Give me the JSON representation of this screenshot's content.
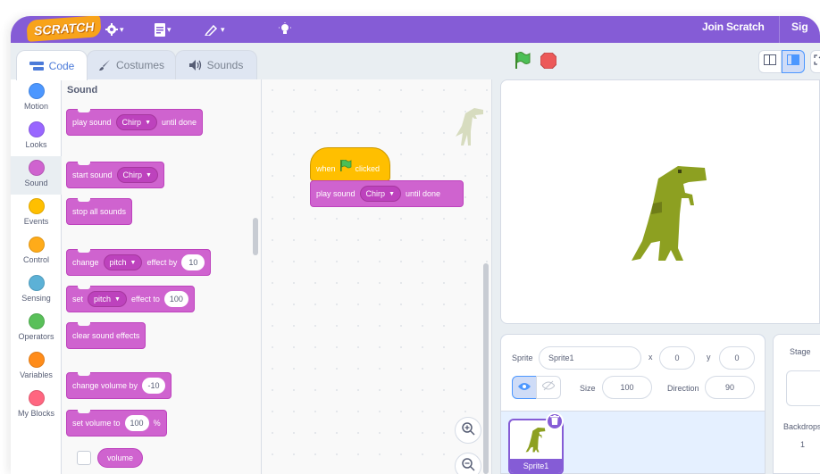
{
  "menubar": {
    "logo": "SCRATCH",
    "join_label": "Join Scratch",
    "signin_label": "Sig",
    "icons": [
      "globe-icon",
      "file-icon",
      "edit-icon",
      "tutorials-icon"
    ]
  },
  "tabs": [
    {
      "label": "Code",
      "icon": "code-icon",
      "active": true
    },
    {
      "label": "Costumes",
      "icon": "brush-icon",
      "active": false
    },
    {
      "label": "Sounds",
      "icon": "speaker-icon",
      "active": false
    }
  ],
  "categories": [
    {
      "label": "Motion",
      "color": "#4c97ff"
    },
    {
      "label": "Looks",
      "color": "#9966ff"
    },
    {
      "label": "Sound",
      "color": "#cf63cf",
      "active": true
    },
    {
      "label": "Events",
      "color": "#ffbf00"
    },
    {
      "label": "Control",
      "color": "#ffab19"
    },
    {
      "label": "Sensing",
      "color": "#5cb1d6"
    },
    {
      "label": "Operators",
      "color": "#59c059"
    },
    {
      "label": "Variables",
      "color": "#ff8c1a"
    },
    {
      "label": "My Blocks",
      "color": "#ff6680"
    }
  ],
  "palette": {
    "title": "Sound",
    "play_until_done": {
      "text1": "play sound",
      "sound": "Chirp",
      "text2": "until done"
    },
    "start_sound": {
      "text1": "start sound",
      "sound": "Chirp"
    },
    "stop_all": "stop all sounds",
    "change_effect": {
      "text1": "change",
      "effect": "pitch",
      "text2": "effect by",
      "value": "10"
    },
    "set_effect": {
      "text1": "set",
      "effect": "pitch",
      "text2": "effect to",
      "value": "100"
    },
    "clear_effects": "clear sound effects",
    "change_volume": {
      "text1": "change volume by",
      "value": "-10"
    },
    "set_volume": {
      "text1": "set volume to",
      "value": "100",
      "unit": "%"
    },
    "volume_reporter": "volume"
  },
  "script": {
    "hat": {
      "text1": "when",
      "text2": "clicked"
    },
    "play": {
      "text1": "play sound",
      "sound": "Chirp",
      "text2": "until done"
    }
  },
  "controls": {
    "green_flag": "green-flag-icon",
    "stop": "stop-icon"
  },
  "colors": {
    "menubar": "#855cd6",
    "sound_block": "#cf63cf",
    "dino": "#8da021"
  },
  "sprite_info": {
    "sprite_label": "Sprite",
    "sprite_name": "Sprite1",
    "x_label": "x",
    "x_value": "0",
    "y_label": "y",
    "y_value": "0",
    "size_label": "Size",
    "size_value": "100",
    "direction_label": "Direction",
    "direction_value": "90"
  },
  "sprite_tile": {
    "name": "Sprite1"
  },
  "stage_pane": {
    "title": "Stage",
    "backdrops_label": "Backdrops",
    "backdrops_count": "1"
  }
}
